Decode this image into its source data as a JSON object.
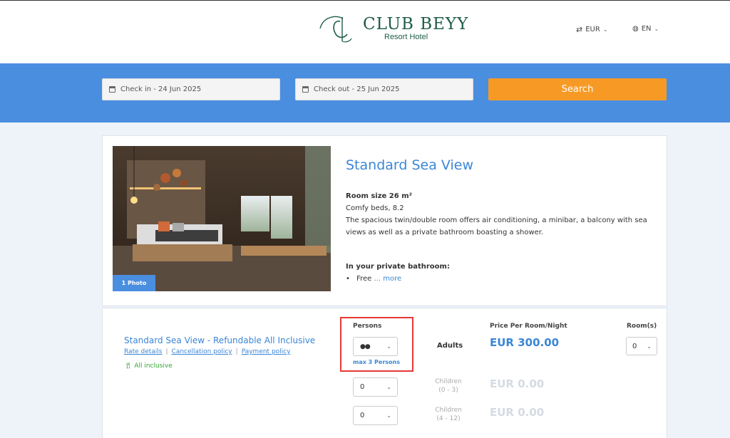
{
  "header": {
    "logo_title": "CLUB BEYY",
    "logo_subtitle": "Resort Hotel",
    "currency": "EUR",
    "language": "EN"
  },
  "search": {
    "check_in": "Check in - 24 Jun 2025",
    "check_out": "Check out - 25 Jun 2025",
    "button_label": "Search"
  },
  "room": {
    "photo_badge": "1 Photo",
    "title": "Standard Sea View",
    "size_label": "Room size 26 m²",
    "beds": "Comfy beds, 8.2",
    "description": "The spacious twin/double room offers air conditioning, a minibar, a balcony with sea views as well as a private bathroom boasting a shower.",
    "bathroom_heading": "In your private bathroom:",
    "bathroom_item": "Free",
    "more_link": "... more"
  },
  "rate": {
    "title": "Standard Sea View - Refundable All Inclusive",
    "links": [
      "Rate details",
      "Cancellation policy",
      "Payment policy"
    ],
    "board": "All inclusive",
    "persons_label": "Persons",
    "persons_icon": "two-persons-icon",
    "max_persons": "max 3 Persons",
    "adults_label": "Adults",
    "price_header": "Price Per Room/Night",
    "adult_price": "EUR 300.00",
    "children": [
      {
        "label": "Children",
        "range": "(0 - 3)",
        "value": "0",
        "price": "EUR 0.00"
      },
      {
        "label": "Children",
        "range": "(4 - 12)",
        "value": "0",
        "price": "EUR 0.00"
      }
    ],
    "rooms_header": "Room(s)",
    "rooms_value": "0"
  },
  "colors": {
    "brand_blue": "#4a8ee0",
    "accent_orange": "#f79a25",
    "highlight_red": "#e53935",
    "logo_green": "#1e5c4a"
  }
}
